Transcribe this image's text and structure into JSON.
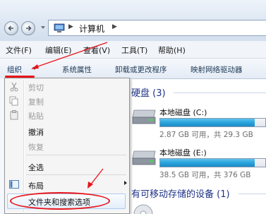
{
  "address": {
    "location": "计算机"
  },
  "menubar": [
    "文件(F)",
    "编辑(E)",
    "查看(V)",
    "工具(T)",
    "帮助(H)"
  ],
  "toolbar": {
    "organize": "组织",
    "system_properties": "系统属性",
    "uninstall": "卸载或更改程序",
    "map_drive": "映射网络驱动器"
  },
  "content": {
    "hdd_group": "硬盘 (3)",
    "drives": [
      {
        "name": "本地磁盘 (C:)",
        "info": "2.87 GB 可用，共 29.3 GB",
        "used_fraction": 0.9
      },
      {
        "name": "本地磁盘 (E:)",
        "info": "38.5 GB 可用，共 376 GB",
        "used_fraction": 0.9
      }
    ],
    "removable_group": "有可移动存储的设备 (1)"
  },
  "dropdown": {
    "cut": "剪切",
    "copy": "复制",
    "paste": "粘贴",
    "undo": "撤消",
    "redo": "恢复",
    "select_all": "全选",
    "layout": "布局",
    "folder_options": "文件夹和搜索选项"
  },
  "colors": {
    "annotation_red": "#e8141b",
    "drive_bar": "#29a3dc",
    "group_title": "#1e3287"
  },
  "icons": [
    "back-icon",
    "forward-icon",
    "computer-icon",
    "scissors-icon",
    "copy-icon",
    "paste-icon",
    "layout-icon",
    "hard-drive-icon",
    "optical-drive-icon"
  ]
}
